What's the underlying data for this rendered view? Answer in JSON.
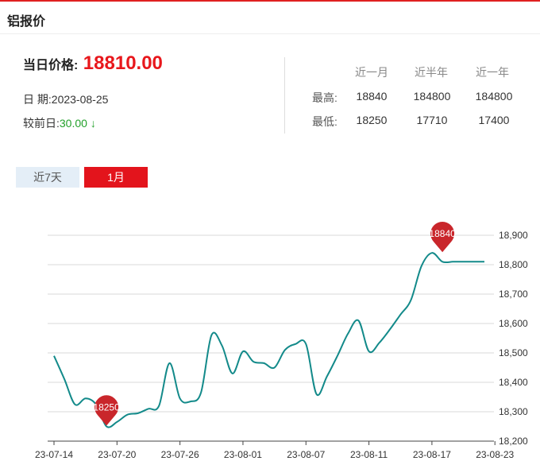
{
  "header": {
    "title": "铝报价"
  },
  "price": {
    "label": "当日价格:",
    "value": "18810.00",
    "date_label": "日 期:",
    "date": "2023-08-25",
    "change_label": "较前日:",
    "change": "30.00 ↓"
  },
  "stats": {
    "columns": [
      "近一月",
      "近半年",
      "近一年"
    ],
    "rows": [
      {
        "label": "最高:",
        "values": [
          "18840",
          "184800",
          "184800"
        ]
      },
      {
        "label": "最低:",
        "values": [
          "18250",
          "17710",
          "17400"
        ]
      }
    ]
  },
  "tabs": [
    "近7天",
    "1月"
  ],
  "active_tab": "1月",
  "colors": {
    "accent_red": "#e02020",
    "price_red": "#e8171c",
    "down_green": "#22a02a",
    "line": "#138a8a",
    "marker": "#c9262b",
    "grid": "#d9d9d9"
  },
  "chart_data": {
    "type": "line",
    "title": "",
    "xlabel": "",
    "ylabel": "",
    "ylim": [
      18200,
      18900
    ],
    "yticks": [
      18200,
      18300,
      18400,
      18500,
      18600,
      18700,
      18800,
      18900
    ],
    "ytick_labels": [
      "18,200",
      "18,300",
      "18,400",
      "18,500",
      "18,600",
      "18,700",
      "18,800",
      "18,900"
    ],
    "xtick_labels": [
      "23-07-14",
      "23-07-20",
      "23-07-26",
      "23-08-01",
      "23-08-07",
      "23-08-11",
      "23-08-17",
      "23-08-23"
    ],
    "grid": true,
    "legend": "none",
    "x": [
      "2023-07-14",
      "2023-07-15",
      "2023-07-16",
      "2023-07-17",
      "2023-07-18",
      "2023-07-19",
      "2023-07-20",
      "2023-07-21",
      "2023-07-22",
      "2023-07-23",
      "2023-07-24",
      "2023-07-25",
      "2023-07-26",
      "2023-07-27",
      "2023-07-28",
      "2023-07-29",
      "2023-07-30",
      "2023-07-31",
      "2023-08-01",
      "2023-08-02",
      "2023-08-03",
      "2023-08-04",
      "2023-08-05",
      "2023-08-06",
      "2023-08-07",
      "2023-08-08",
      "2023-08-09",
      "2023-08-10",
      "2023-08-11",
      "2023-08-12",
      "2023-08-13",
      "2023-08-14",
      "2023-08-15",
      "2023-08-16",
      "2023-08-17",
      "2023-08-18",
      "2023-08-19",
      "2023-08-20",
      "2023-08-21",
      "2023-08-22",
      "2023-08-23",
      "2023-08-24"
    ],
    "series": [
      {
        "values": [
          18490,
          18410,
          18325,
          18345,
          18325,
          18250,
          18265,
          18290,
          18295,
          18310,
          18320,
          18465,
          18345,
          18335,
          18365,
          18560,
          18525,
          18430,
          18505,
          18470,
          18465,
          18450,
          18510,
          18530,
          18530,
          18360,
          18420,
          18490,
          18565,
          18610,
          18505,
          18535,
          18580,
          18630,
          18680,
          18795,
          18840,
          18810,
          18810,
          18810,
          18810,
          18810
        ],
        "color": "#138a8a"
      }
    ],
    "markers": [
      {
        "label": "18250",
        "x": "2023-07-19",
        "y": 18250
      },
      {
        "label": "18840",
        "x": "2023-08-20",
        "y": 18840
      }
    ]
  }
}
